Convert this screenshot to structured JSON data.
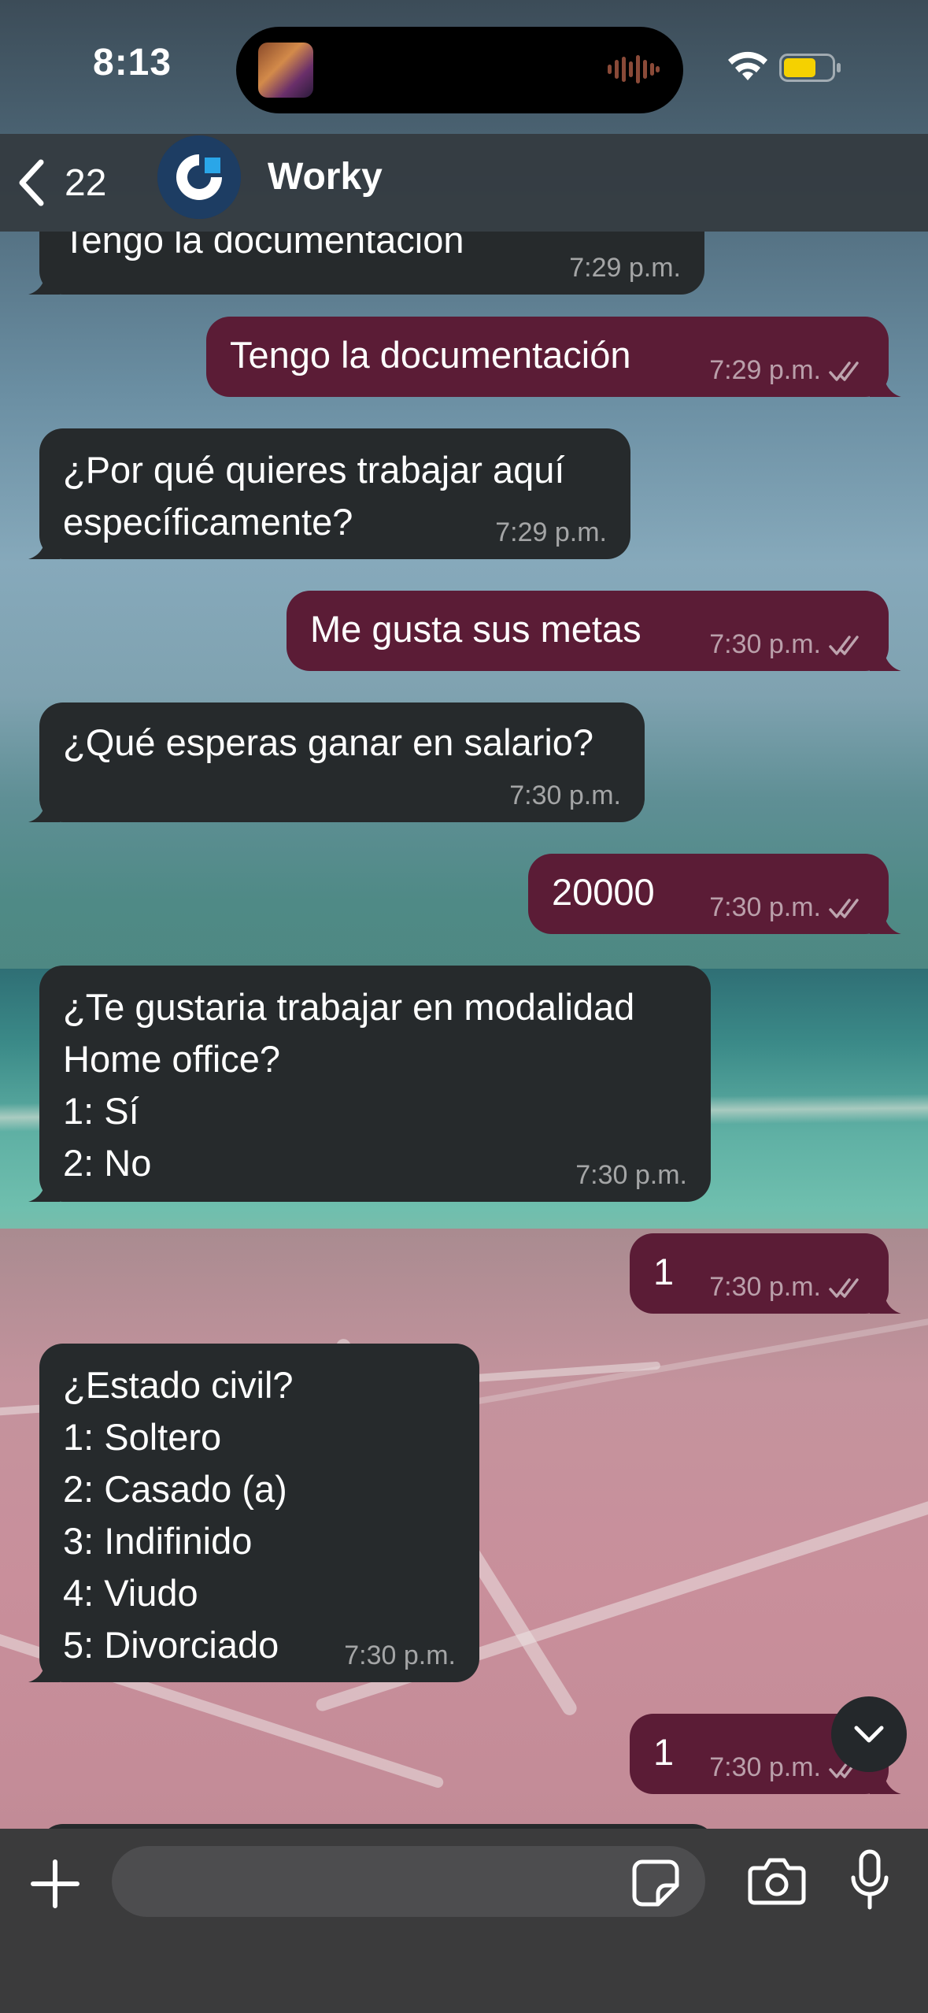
{
  "status_bar": {
    "time": "8:13"
  },
  "header": {
    "back_count": "22",
    "contact_name": "Worky"
  },
  "messages": [
    {
      "direction": "incoming",
      "text": "Tengo la documentación",
      "time": "7:29 p.m."
    },
    {
      "direction": "outgoing",
      "text": "Tengo la documentación",
      "time": "7:29 p.m.",
      "status": "read"
    },
    {
      "direction": "incoming",
      "text": "¿Por qué quieres trabajar aquí\nespecíficamente?",
      "time": "7:29 p.m."
    },
    {
      "direction": "outgoing",
      "text": "Me gusta sus metas",
      "time": "7:30 p.m.",
      "status": "read"
    },
    {
      "direction": "incoming",
      "text": "¿Qué esperas ganar en salario?",
      "time": "7:30 p.m."
    },
    {
      "direction": "outgoing",
      "text": "20000",
      "time": "7:30 p.m.",
      "status": "read"
    },
    {
      "direction": "incoming",
      "text": "¿Te gustaria trabajar en modalidad\nHome office?\n1: Sí\n2: No",
      "time": "7:30 p.m."
    },
    {
      "direction": "outgoing",
      "text": "1",
      "time": "7:30 p.m.",
      "status": "read"
    },
    {
      "direction": "incoming",
      "text": "¿Estado civil?\n1: Soltero\n2: Casado (a)\n3: Indifinido\n4: Viudo\n5: Divorciado",
      "time": "7:30 p.m."
    },
    {
      "direction": "outgoing",
      "text": "1",
      "time": "7:30 p.m.",
      "status": "read"
    }
  ],
  "input_bar": {
    "placeholder": ""
  },
  "colors": {
    "incoming_bubble": "#262a2c",
    "outgoing_bubble": "#5b1c36",
    "header_bg": "#343a40",
    "input_bar_bg": "#3b3b3c",
    "battery_fill": "#f5d100"
  },
  "icons": {
    "back": "chevron-left-icon",
    "plus": "plus-icon",
    "sticker": "sticker-icon",
    "camera": "camera-icon",
    "mic": "microphone-icon",
    "scroll_down": "chevron-down-icon",
    "read_receipt": "double-check-icon"
  }
}
